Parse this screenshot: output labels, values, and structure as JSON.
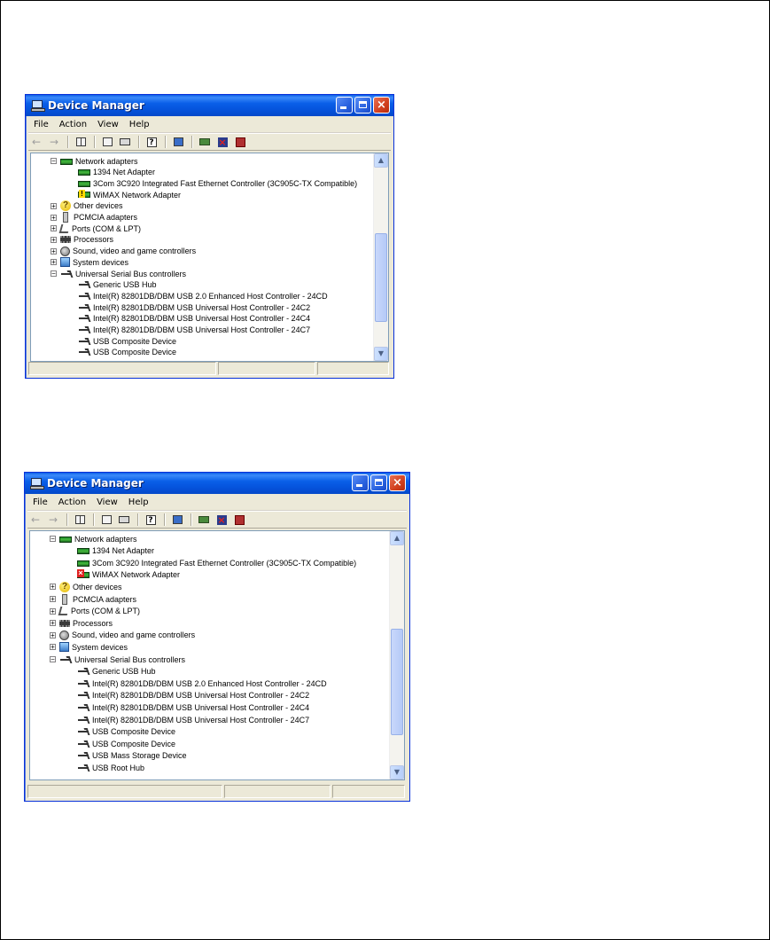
{
  "windows": [
    {
      "title": "Device Manager",
      "menu": [
        "File",
        "Action",
        "View",
        "Help"
      ],
      "tree": [
        {
          "label": "Network adapters",
          "level": 0,
          "expander": "−",
          "icon": "net"
        },
        {
          "label": "1394 Net Adapter",
          "level": 1,
          "icon": "net"
        },
        {
          "label": "3Com 3C920 Integrated Fast Ethernet Controller (3C905C-TX Compatible)",
          "level": 1,
          "icon": "net"
        },
        {
          "label": "WiMAX Network Adapter",
          "level": 1,
          "icon": "net-warn"
        },
        {
          "label": "Other devices",
          "level": 0,
          "expander": "+",
          "icon": "question"
        },
        {
          "label": "PCMCIA adapters",
          "level": 0,
          "expander": "+",
          "icon": "pcmcia"
        },
        {
          "label": "Ports (COM & LPT)",
          "level": 0,
          "expander": "+",
          "icon": "port"
        },
        {
          "label": "Processors",
          "level": 0,
          "expander": "+",
          "icon": "cpu"
        },
        {
          "label": "Sound, video and game controllers",
          "level": 0,
          "expander": "+",
          "icon": "speaker"
        },
        {
          "label": "System devices",
          "level": 0,
          "expander": "+",
          "icon": "system"
        },
        {
          "label": "Universal Serial Bus controllers",
          "level": 0,
          "expander": "−",
          "icon": "usb"
        },
        {
          "label": "Generic USB Hub",
          "level": 1,
          "icon": "usb"
        },
        {
          "label": "Intel(R) 82801DB/DBM USB 2.0 Enhanced Host Controller - 24CD",
          "level": 1,
          "icon": "usb"
        },
        {
          "label": "Intel(R) 82801DB/DBM USB Universal Host Controller - 24C2",
          "level": 1,
          "icon": "usb"
        },
        {
          "label": "Intel(R) 82801DB/DBM USB Universal Host Controller - 24C4",
          "level": 1,
          "icon": "usb"
        },
        {
          "label": "Intel(R) 82801DB/DBM USB Universal Host Controller - 24C7",
          "level": 1,
          "icon": "usb"
        },
        {
          "label": "USB Composite Device",
          "level": 1,
          "icon": "usb"
        },
        {
          "label": "USB Composite Device",
          "level": 1,
          "icon": "usb"
        }
      ]
    },
    {
      "title": "Device Manager",
      "menu": [
        "File",
        "Action",
        "View",
        "Help"
      ],
      "tree": [
        {
          "label": "Network adapters",
          "level": 0,
          "expander": "−",
          "icon": "net"
        },
        {
          "label": "1394 Net Adapter",
          "level": 1,
          "icon": "net"
        },
        {
          "label": "3Com 3C920 Integrated Fast Ethernet Controller (3C905C-TX Compatible)",
          "level": 1,
          "icon": "net"
        },
        {
          "label": "WiMAX Network Adapter",
          "level": 1,
          "icon": "net-err"
        },
        {
          "label": "Other devices",
          "level": 0,
          "expander": "+",
          "icon": "question"
        },
        {
          "label": "PCMCIA adapters",
          "level": 0,
          "expander": "+",
          "icon": "pcmcia"
        },
        {
          "label": "Ports (COM & LPT)",
          "level": 0,
          "expander": "+",
          "icon": "port"
        },
        {
          "label": "Processors",
          "level": 0,
          "expander": "+",
          "icon": "cpu"
        },
        {
          "label": "Sound, video and game controllers",
          "level": 0,
          "expander": "+",
          "icon": "speaker"
        },
        {
          "label": "System devices",
          "level": 0,
          "expander": "+",
          "icon": "system"
        },
        {
          "label": "Universal Serial Bus controllers",
          "level": 0,
          "expander": "−",
          "icon": "usb"
        },
        {
          "label": "Generic USB Hub",
          "level": 1,
          "icon": "usb"
        },
        {
          "label": "Intel(R) 82801DB/DBM USB 2.0 Enhanced Host Controller - 24CD",
          "level": 1,
          "icon": "usb"
        },
        {
          "label": "Intel(R) 82801DB/DBM USB Universal Host Controller - 24C2",
          "level": 1,
          "icon": "usb"
        },
        {
          "label": "Intel(R) 82801DB/DBM USB Universal Host Controller - 24C4",
          "level": 1,
          "icon": "usb"
        },
        {
          "label": "Intel(R) 82801DB/DBM USB Universal Host Controller - 24C7",
          "level": 1,
          "icon": "usb"
        },
        {
          "label": "USB Composite Device",
          "level": 1,
          "icon": "usb"
        },
        {
          "label": "USB Composite Device",
          "level": 1,
          "icon": "usb"
        },
        {
          "label": "USB Mass Storage Device",
          "level": 1,
          "icon": "usb"
        },
        {
          "label": "USB Root Hub",
          "level": 1,
          "icon": "usb"
        }
      ]
    }
  ],
  "toolbar_icons": [
    "back-icon",
    "forward-icon",
    "show-hide-tree-icon",
    "properties-icon",
    "print-icon",
    "help-icon",
    "scan-hardware-icon",
    "update-driver-icon",
    "uninstall-icon",
    "disable-icon"
  ]
}
